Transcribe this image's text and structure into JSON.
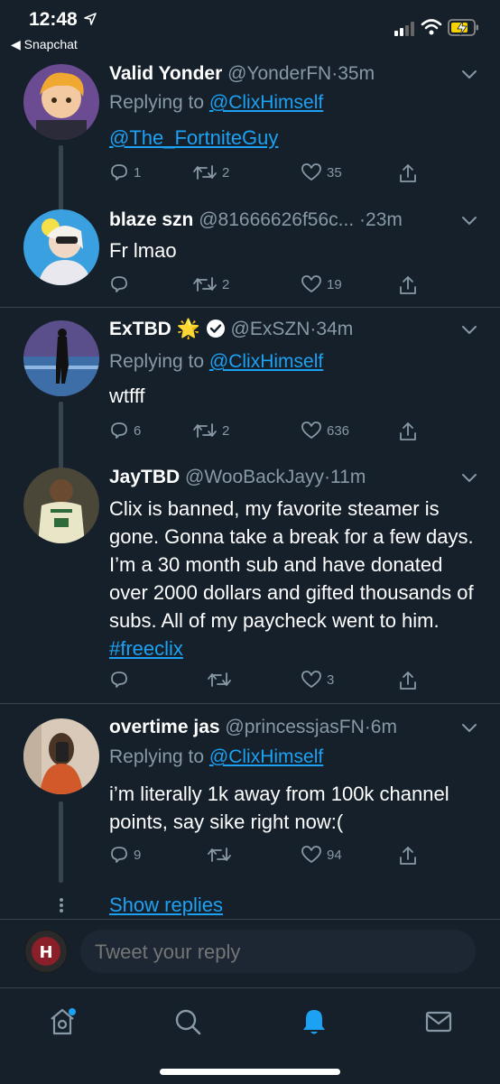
{
  "status_bar": {
    "time": "12:48",
    "back_app": "◀ Snapchat"
  },
  "tweets": [
    {
      "name": "Valid Yonder",
      "handle": "@YonderFN",
      "time": "·35m",
      "replying_prefix": "Replying to ",
      "replying_to": "@ClixHimself",
      "body_mention": "@The_FortniteGuy",
      "replies": "1",
      "retweets": "2",
      "likes": "35"
    },
    {
      "name": "blaze szn",
      "handle": "@81666626f56c...",
      "time": "·23m",
      "body": "Fr lmao",
      "replies": "",
      "retweets": "2",
      "likes": "19"
    },
    {
      "name": "ExTBD",
      "badge_emoji": "🌟",
      "handle": "@ExSZN",
      "time": "·34m",
      "replying_prefix": "Replying to ",
      "replying_to": "@ClixHimself",
      "body": "wtfff",
      "replies": "6",
      "retweets": "2",
      "likes": "636"
    },
    {
      "name": "JayTBD",
      "handle": "@WooBackJayy",
      "time": "·11m",
      "body": "Clix is banned, my favorite steamer is gone. Gonna take a break for a few days. I’m a 30 month sub and have donated over 2000 dollars and gifted thousands of subs. All of my paycheck went to him. ",
      "hashtag": "#freeclix",
      "replies": "",
      "retweets": "",
      "likes": "3"
    },
    {
      "name": "overtime jas",
      "handle": "@princessjasFN",
      "time": "·6m",
      "replying_prefix": "Replying to ",
      "replying_to": "@ClixHimself",
      "body": "i’m literally 1k away from 100k channel points, say sike right now:(",
      "replies": "9",
      "retweets": "",
      "likes": "94"
    }
  ],
  "show_replies": "Show replies",
  "compose": {
    "placeholder": "Tweet your reply"
  },
  "colors": {
    "background": "#15202b",
    "accent": "#1da1f2",
    "secondary_text": "#8899a6",
    "divider": "#38444d"
  },
  "icons": [
    "location-arrow-icon",
    "signal-icon",
    "wifi-icon",
    "battery-charging-icon",
    "chevron-down-icon",
    "reply-icon",
    "retweet-icon",
    "like-icon",
    "share-icon",
    "verified-icon",
    "home-icon",
    "search-icon",
    "notifications-icon",
    "messages-icon"
  ]
}
